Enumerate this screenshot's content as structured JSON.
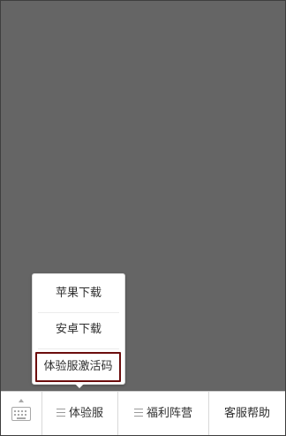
{
  "popup_menu": {
    "items": [
      {
        "label": "苹果下载"
      },
      {
        "label": "安卓下载"
      },
      {
        "label": "体验服激活码"
      }
    ]
  },
  "bottom_bar": {
    "keyboard": {
      "icon": "keyboard-icon"
    },
    "tabs": [
      {
        "label": "体验服",
        "icon": "menu-lines-icon"
      },
      {
        "label": "福利阵营",
        "icon": "menu-lines-icon"
      },
      {
        "label": "客服帮助"
      }
    ]
  },
  "colors": {
    "content_background": "#656565",
    "highlight_border": "#6b0d0d",
    "bar_background": "#ffffff"
  }
}
